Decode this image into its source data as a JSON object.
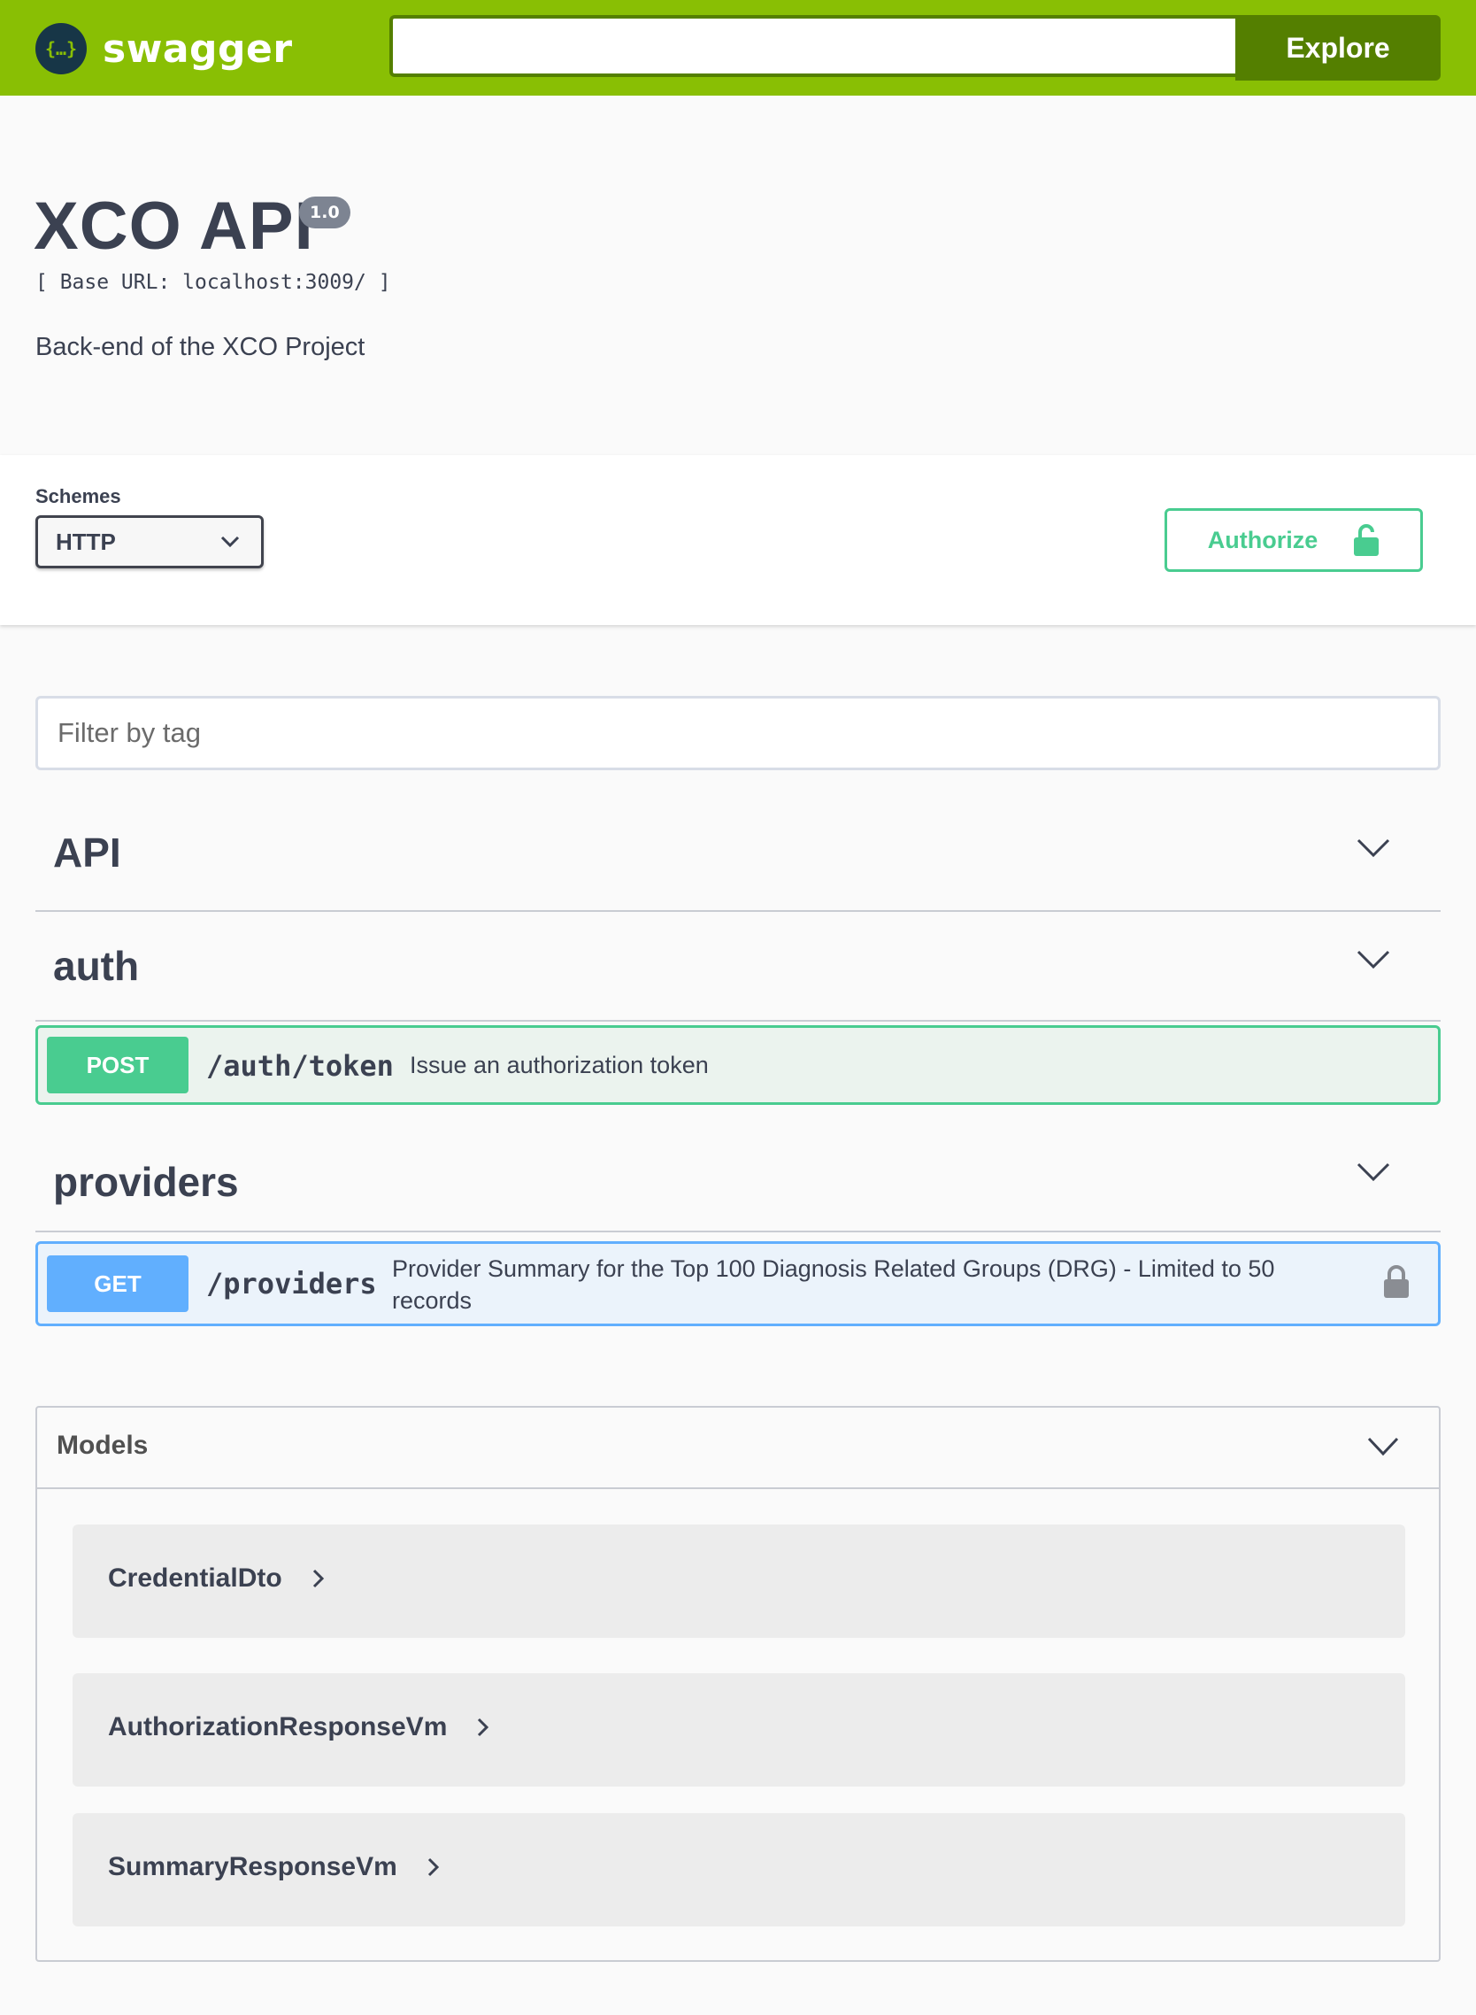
{
  "topbar": {
    "brand": "swagger",
    "logo_glyph": "{…}",
    "search_value": "",
    "explore_label": "Explore",
    "colors": {
      "bar": "#89bf04",
      "button": "#547f00"
    }
  },
  "info": {
    "title": "XCO API",
    "version": "1.0",
    "base_url": "[ Base URL: localhost:3009/ ]",
    "description": "Back-end of the XCO Project"
  },
  "schemes": {
    "label": "Schemes",
    "selected": "HTTP"
  },
  "authorize": {
    "label": "Authorize",
    "icon": "unlock-icon",
    "color": "#49cc90"
  },
  "filter": {
    "placeholder": "Filter by tag"
  },
  "tags": [
    {
      "name": "API"
    },
    {
      "name": "auth"
    },
    {
      "name": "providers"
    }
  ],
  "operations": [
    {
      "method": "POST",
      "path": "/auth/token",
      "summary": "Issue an authorization token",
      "color": "#49cc90"
    },
    {
      "method": "GET",
      "path": "/providers",
      "summary_line1": "Provider Summary for the Top 100 Diagnosis Related Groups (DRG) - Limited to 50",
      "summary_line2": "records",
      "color": "#61affe",
      "icon": "lock-icon"
    }
  ],
  "models": {
    "title": "Models",
    "items": [
      {
        "name": "CredentialDto"
      },
      {
        "name": "AuthorizationResponseVm"
      },
      {
        "name": "SummaryResponseVm"
      }
    ]
  }
}
